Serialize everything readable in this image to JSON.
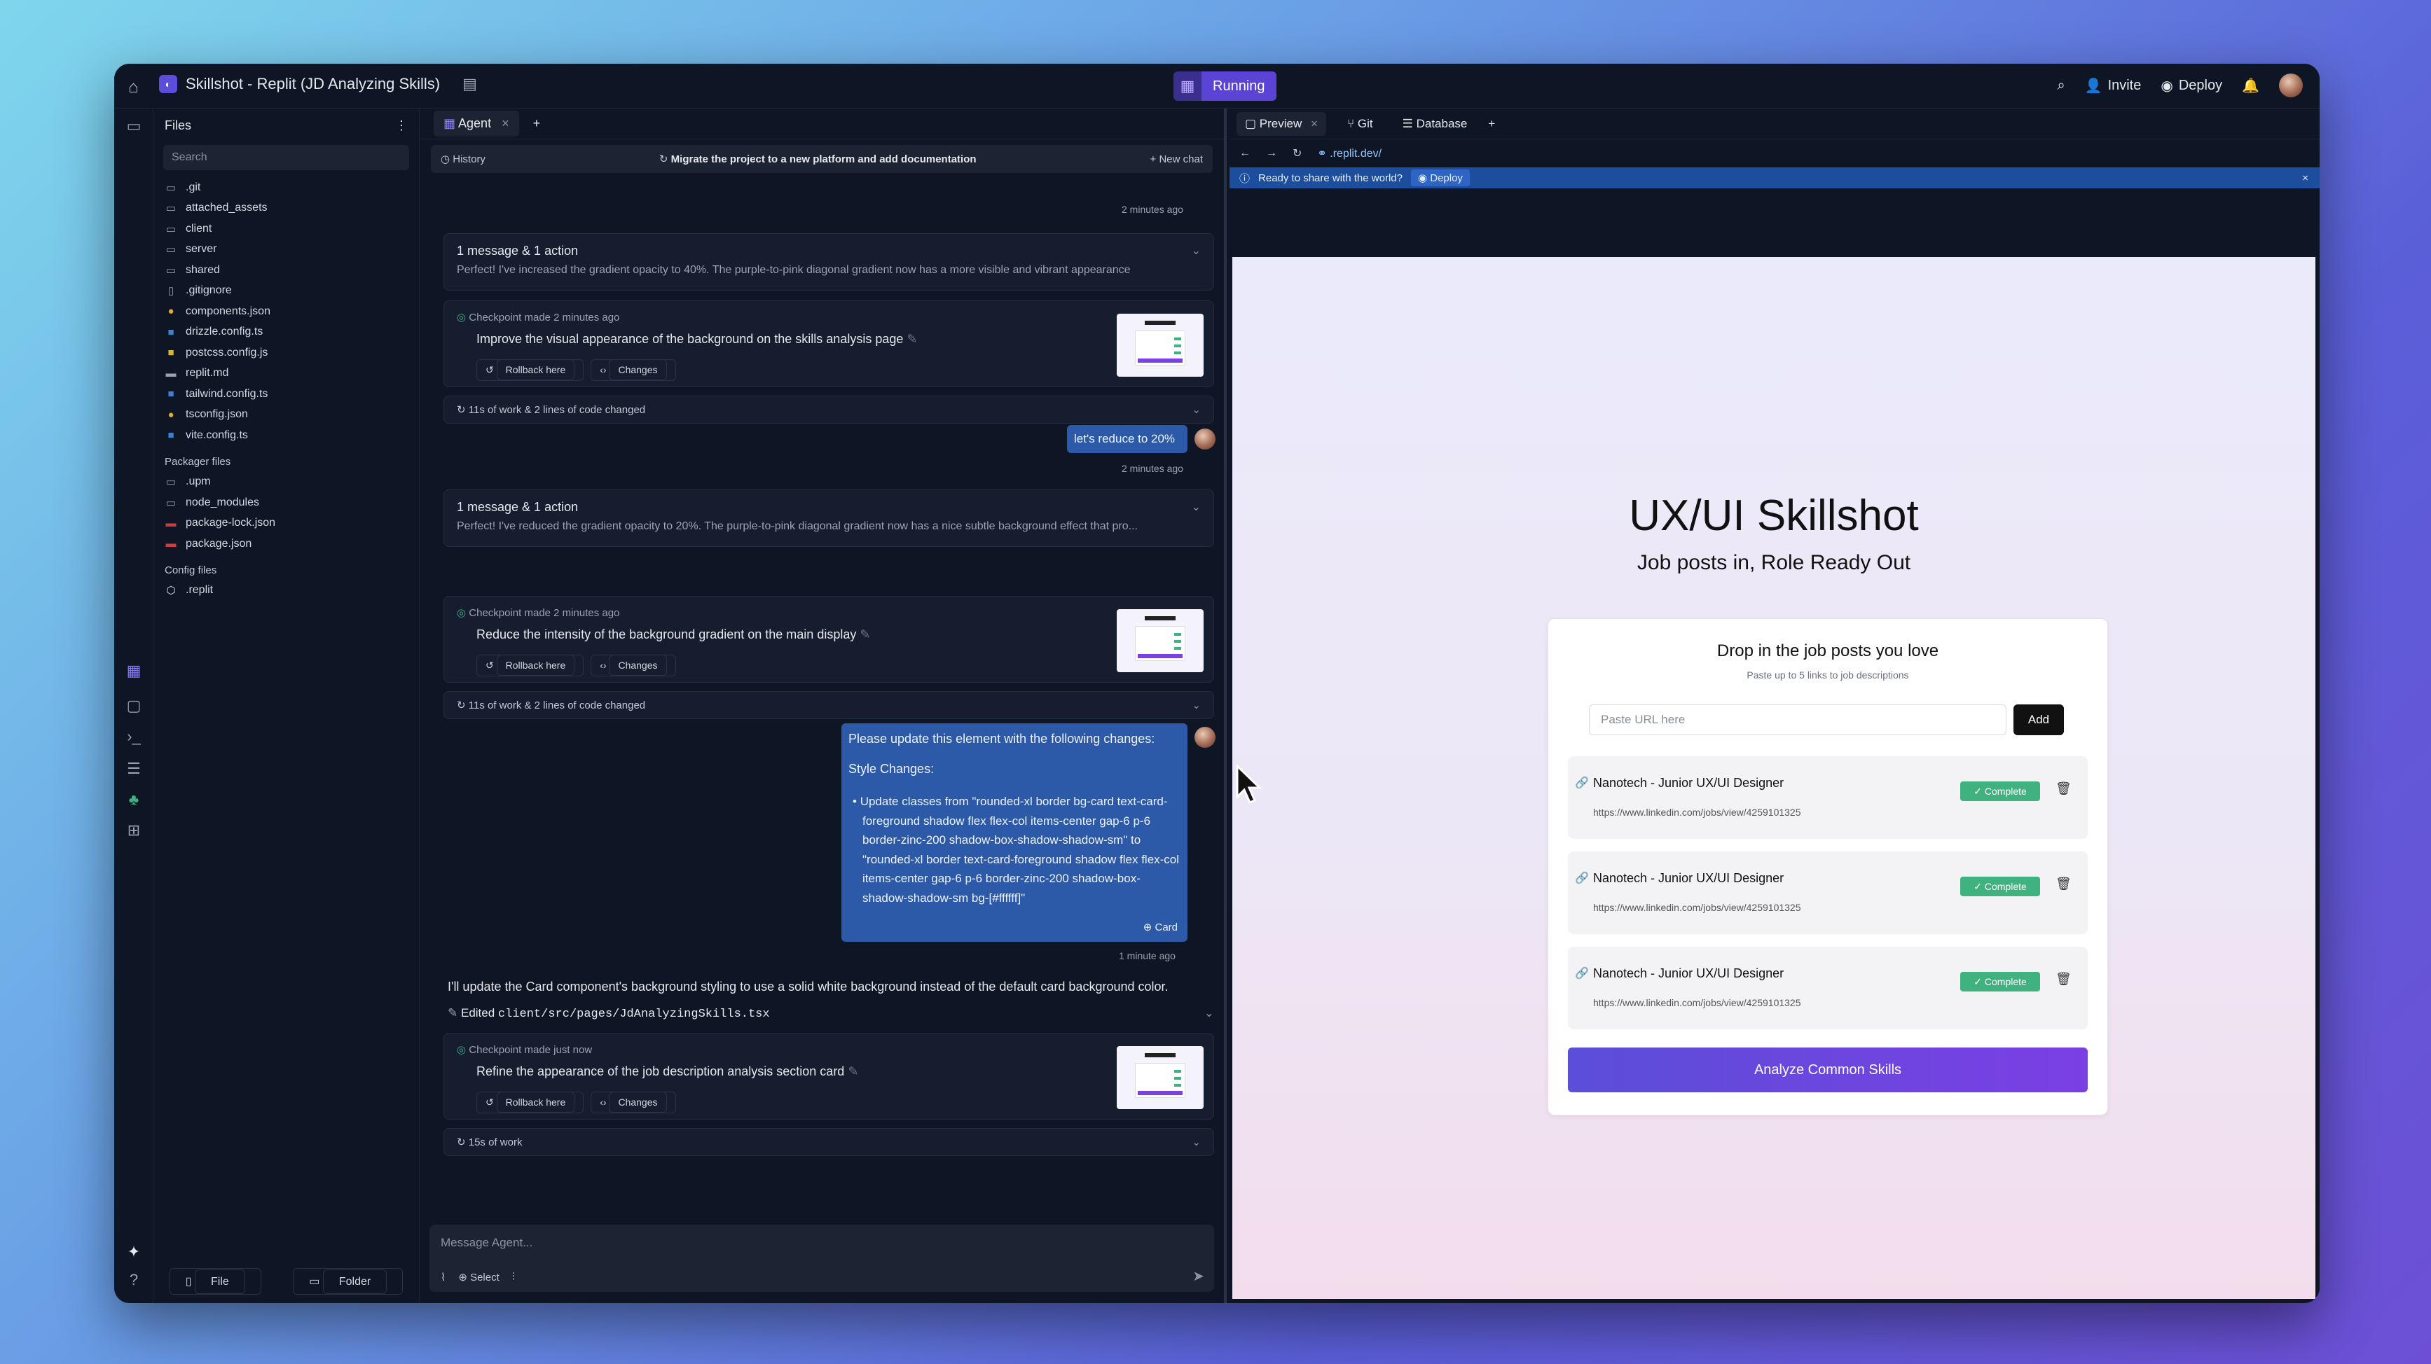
{
  "topbar": {
    "app_title": "Skillshot - Replit (JD Analyzing Skills)",
    "run_label": "Running",
    "invite_label": "Invite",
    "deploy_label": "Deploy"
  },
  "files": {
    "header": "Files",
    "search_placeholder": "Search",
    "items": [
      {
        "icon": "folder-icon",
        "name": ".git"
      },
      {
        "icon": "folder-icon",
        "name": "attached_assets"
      },
      {
        "icon": "folder-icon",
        "name": "client"
      },
      {
        "icon": "folder-icon",
        "name": "server"
      },
      {
        "icon": "folder-icon",
        "name": "shared"
      },
      {
        "icon": "file-icon",
        "name": ".gitignore"
      },
      {
        "icon": "json-icon",
        "name": "components.json"
      },
      {
        "icon": "ts-icon",
        "name": "drizzle.config.ts"
      },
      {
        "icon": "js-icon",
        "name": "postcss.config.js"
      },
      {
        "icon": "md-icon",
        "name": "replit.md"
      },
      {
        "icon": "ts-icon",
        "name": "tailwind.config.ts"
      },
      {
        "icon": "json-icon",
        "name": "tsconfig.json"
      },
      {
        "icon": "ts-icon",
        "name": "vite.config.ts"
      }
    ],
    "packager_header": "Packager files",
    "packager_items": [
      {
        "icon": "folder-icon",
        "name": ".upm"
      },
      {
        "icon": "folder-icon",
        "name": "node_modules"
      },
      {
        "icon": "npm-icon",
        "name": "package-lock.json"
      },
      {
        "icon": "npm-icon",
        "name": "package.json"
      }
    ],
    "config_header": "Config files",
    "config_items": [
      {
        "icon": "replit-icon",
        "name": ".replit"
      }
    ],
    "new_file": "File",
    "new_folder": "Folder"
  },
  "agent": {
    "tab_label": "Agent",
    "history_label": "History",
    "history_title": "Migrate the project to a new platform and add documentation",
    "new_chat": "New chat",
    "time1": "2 minutes ago",
    "msg1_title": "1 message & 1 action",
    "msg1_text": "Perfect! I've increased the gradient opacity to 40%. The purple-to-pink diagonal gradient now has a more visible and vibrant appearance",
    "ckpt1_line": "Checkpoint made 2 minutes ago",
    "ckpt1_task": "Improve the visual appearance of the background on the skills analysis page",
    "rollback": "Rollback here",
    "changes": "Changes",
    "work1": "11s of work & 2 lines of code changed",
    "user1": "let's reduce to 20%",
    "time2": "2 minutes ago",
    "msg2_title": "1 message & 1 action",
    "msg2_text": "Perfect! I've reduced the gradient opacity to 20%. The purple-to-pink diagonal gradient now has a nice subtle background effect that pro...",
    "ckpt2_line": "Checkpoint made 2 minutes ago",
    "ckpt2_task": "Reduce the intensity of the background gradient on the main display",
    "work2": "11s of work & 2 lines of code changed",
    "user2_line1": "Please update this element with the following changes:",
    "user2_line2": "Style Changes:",
    "user2_bullet": "Update classes from \"rounded-xl border bg-card text-card-foreground shadow flex flex-col items-center gap-6 p-6 border-zinc-200 shadow-box-shadow-shadow-sm\" to \"rounded-xl border text-card-foreground shadow flex flex-col items-center gap-6 p-6 border-zinc-200 shadow-box-shadow-shadow-sm bg-[#ffffff]\"",
    "user2_tag": "Card",
    "time3": "1 minute ago",
    "reply3": "I'll update the Card component's background styling to use a solid white background instead of the default card background color.",
    "edited_label": "Edited",
    "edited_file": "client/src/pages/JdAnalyzingSkills.tsx",
    "ckpt3_line": "Checkpoint made just now",
    "ckpt3_task": "Refine the appearance of the job description analysis section card",
    "work3": "15s of work",
    "input_placeholder": "Message Agent...",
    "select_label": "Select"
  },
  "preview": {
    "tabs": [
      "Preview",
      "Git",
      "Database"
    ],
    "url": ".replit.dev/",
    "banner_text": "Ready to share with the world?",
    "banner_btn": "Deploy",
    "site_title": "UX/UI Skillshot",
    "site_sub": "Job posts in, Role Ready Out",
    "panel_head": "Drop in the job posts you love",
    "panel_sub": "Paste up to 5 links to job descriptions",
    "url_placeholder": "Paste URL here",
    "add_label": "Add",
    "jobs": [
      {
        "title": "Nanotech - Junior UX/UI Designer",
        "url": "https://www.linkedin.com/jobs/view/4259101325",
        "status": "Complete"
      },
      {
        "title": "Nanotech - Junior UX/UI Designer",
        "url": "https://www.linkedin.com/jobs/view/4259101325",
        "status": "Complete"
      },
      {
        "title": "Nanotech - Junior UX/UI Designer",
        "url": "https://www.linkedin.com/jobs/view/4259101325",
        "status": "Complete"
      }
    ],
    "analyze_label": "Analyze Common Skills"
  },
  "colors": {
    "accent": "#5b43d6",
    "user_bubble": "#2c5aa8",
    "complete": "#3fb27f",
    "button_gradient_end": "#7b3fe4"
  }
}
